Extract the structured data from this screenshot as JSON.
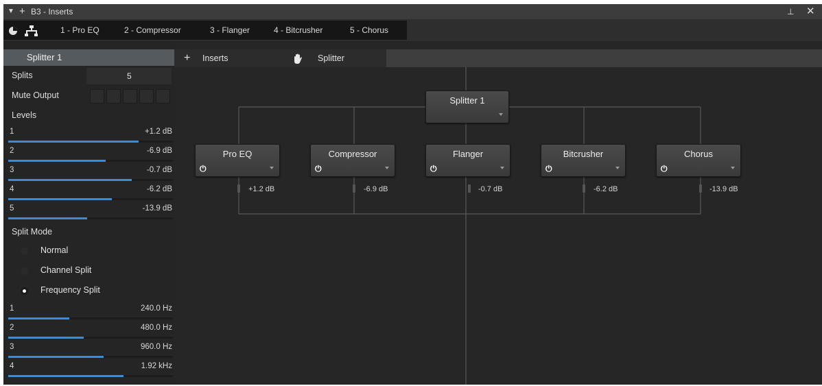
{
  "window": {
    "title": "B3 - Inserts",
    "tabs": [
      {
        "label": "1 - Pro EQ"
      },
      {
        "label": "2 - Compressor"
      },
      {
        "label": "3 - Flanger"
      },
      {
        "label": "4 - Bitcrusher"
      },
      {
        "label": "5 - Chorus"
      }
    ]
  },
  "left_panel": {
    "device_name": "Splitter 1",
    "splits_label": "Splits",
    "splits_value": "5",
    "mute_output_label": "Mute Output",
    "levels_label": "Levels",
    "levels": [
      {
        "index": "1",
        "value": "+1.2 dB",
        "fill": 0.79
      },
      {
        "index": "2",
        "value": "-6.9 dB",
        "fill": 0.59
      },
      {
        "index": "3",
        "value": "-0.7 dB",
        "fill": 0.75
      },
      {
        "index": "4",
        "value": "-6.2 dB",
        "fill": 0.63
      },
      {
        "index": "5",
        "value": "-13.9 dB",
        "fill": 0.48
      }
    ],
    "split_mode_label": "Split Mode",
    "split_modes": [
      {
        "label": "Normal",
        "selected": false
      },
      {
        "label": "Channel Split",
        "selected": false
      },
      {
        "label": "Frequency Split",
        "selected": true
      }
    ],
    "frequencies": [
      {
        "index": "1",
        "value": "240.0 Hz",
        "fill": 0.37
      },
      {
        "index": "2",
        "value": "480.0 Hz",
        "fill": 0.46
      },
      {
        "index": "3",
        "value": "960.0 Hz",
        "fill": 0.58
      },
      {
        "index": "4",
        "value": "1.92 kHz",
        "fill": 0.7
      }
    ]
  },
  "routing": {
    "inserts_label": "Inserts",
    "splitter_label": "Splitter",
    "splitter_node": "Splitter 1",
    "nodes": [
      {
        "name": "Pro EQ",
        "gain": "+1.2 dB"
      },
      {
        "name": "Compressor",
        "gain": "-6.9 dB"
      },
      {
        "name": "Flanger",
        "gain": "-0.7 dB"
      },
      {
        "name": "Bitcrusher",
        "gain": "-6.2 dB"
      },
      {
        "name": "Chorus",
        "gain": "-13.9 dB"
      }
    ]
  },
  "colors": {
    "accent": "#2f8fe3",
    "background": "#2a2a2a"
  },
  "icons": [
    "collapse-arrow-icon",
    "add-icon",
    "pin-icon",
    "close-icon",
    "view-toggle-icon",
    "routing-icon",
    "hand-icon",
    "power-icon"
  ]
}
